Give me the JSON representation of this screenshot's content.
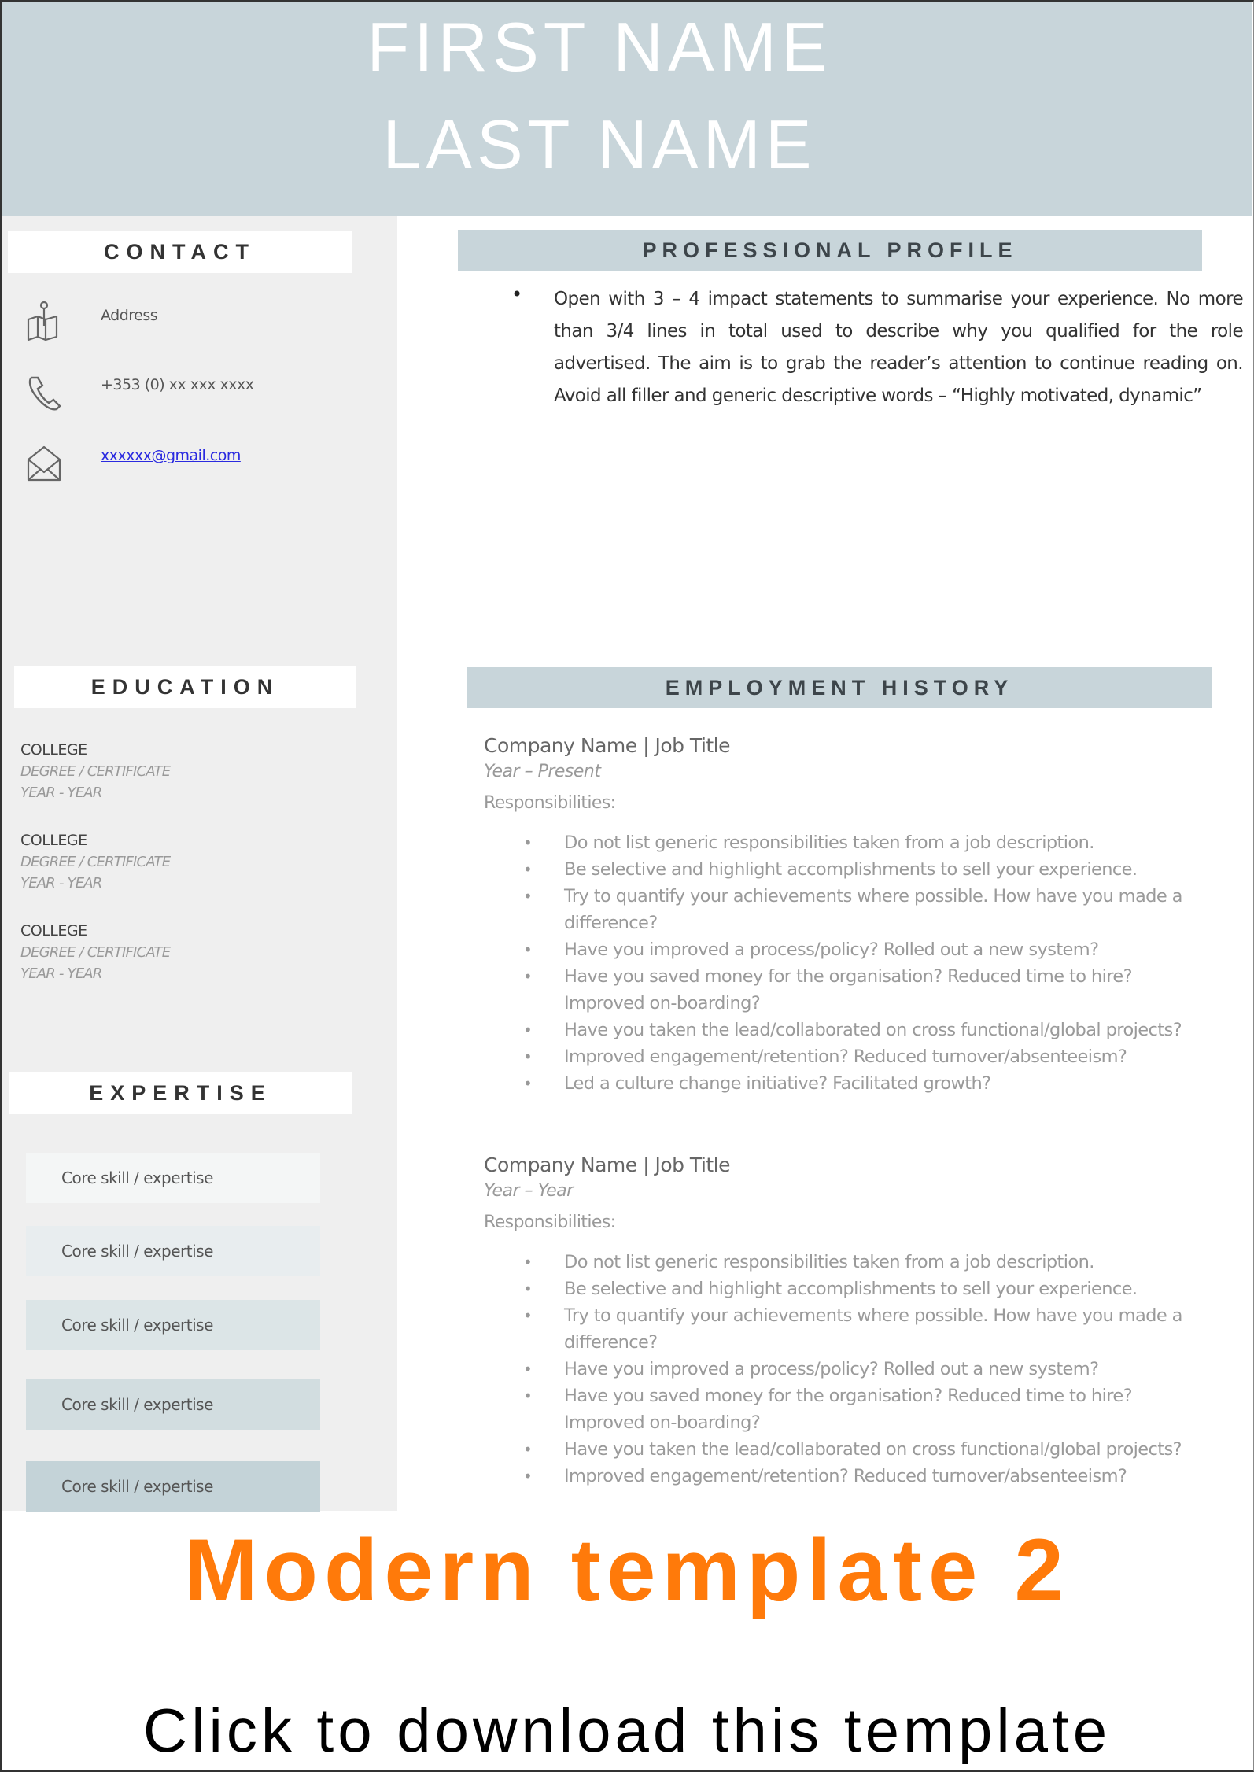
{
  "header": {
    "first_name": "FIRST NAME",
    "last_name": "LAST NAME"
  },
  "sidebar": {
    "contact": {
      "heading": "CONTACT",
      "items": [
        {
          "icon": "map-location-icon",
          "text": "Address"
        },
        {
          "icon": "phone-icon",
          "text": "+353 (0) xx xxx xxxx"
        },
        {
          "icon": "envelope-icon",
          "text": "xxxxxx@gmail.com"
        }
      ]
    },
    "education": {
      "heading": "EDUCATION",
      "items": [
        {
          "college": "COLLEGE",
          "degree": "DEGREE / CERTIFICATE",
          "years": "YEAR - YEAR"
        },
        {
          "college": "COLLEGE",
          "degree": "DEGREE / CERTIFICATE",
          "years": "YEAR - YEAR"
        },
        {
          "college": "COLLEGE",
          "degree": "DEGREE / CERTIFICATE",
          "years": "YEAR - YEAR"
        }
      ]
    },
    "expertise": {
      "heading": "EXPERTISE",
      "items": [
        {
          "label": "Core skill / expertise",
          "color": "#f4f6f6"
        },
        {
          "label": "Core skill / expertise",
          "color": "#e8edef"
        },
        {
          "label": "Core skill / expertise",
          "color": "#dce5e7"
        },
        {
          "label": "Core skill / expertise",
          "color": "#d2dde0"
        },
        {
          "label": "Core skill / expertise",
          "color": "#c4d3d8"
        }
      ]
    }
  },
  "main": {
    "profile": {
      "heading": "PROFESSIONAL PROFILE",
      "text": "Open with 3 – 4 impact statements to summarise your experience.  No more than 3/4 lines in total used to describe why you qualified for the role advertised. The aim is to grab the reader’s attention to continue reading on. Avoid all filler and generic descriptive words – “Highly motivated, dynamic”"
    },
    "employment": {
      "heading": "EMPLOYMENT HISTORY",
      "jobs": [
        {
          "title": "Company Name | Job Title",
          "dates": "Year – Present",
          "responsibilities_label": "Responsibilities:",
          "bullets": [
            "Do not list generic responsibilities taken from a job description.",
            "Be selective and highlight accomplishments to sell your experience.",
            "Try to quantify your achievements where possible. How have you made a difference?",
            "Have you improved a process/policy? Rolled out a new system?",
            "Have you saved money for the organisation? Reduced time to hire? Improved on-boarding?",
            "Have you taken the lead/collaborated on cross functional/global projects?",
            "Improved engagement/retention? Reduced turnover/absenteeism?",
            "Led a culture change initiative? Facilitated growth?"
          ]
        },
        {
          "title": "Company Name | Job Title",
          "dates": "Year – Year",
          "responsibilities_label": "Responsibilities:",
          "bullets": [
            "Do not list generic responsibilities taken from a job description.",
            "Be selective and highlight accomplishments to sell your experience.",
            "Try to quantify your achievements where possible. How have you made a difference?",
            "Have you improved a process/policy? Rolled out a new system?",
            "Have you saved money for the organisation? Reduced time to hire? Improved on-boarding?",
            "Have you taken the lead/collaborated on cross functional/global projects?",
            "Improved engagement/retention? Reduced turnover/absenteeism?"
          ]
        }
      ]
    }
  },
  "caption": {
    "title": "Modern template 2",
    "cta": "Click to download this template",
    "title_color": "#ff7a0a"
  },
  "colors": {
    "header_bg": "#c8d5da",
    "sidebar_bg": "#efefef",
    "section_heading_bg": "#c8d5da",
    "link": "#2a2ae0"
  }
}
